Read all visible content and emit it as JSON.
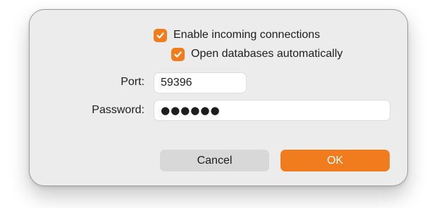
{
  "dialog": {
    "options": {
      "enable_incoming": {
        "label": "Enable incoming connections",
        "checked": true
      },
      "open_databases": {
        "label": "Open databases automatically",
        "checked": true
      }
    },
    "port": {
      "label": "Port:",
      "value": "59396"
    },
    "password": {
      "label": "Password:",
      "masked_value": "●●●●●●"
    },
    "buttons": {
      "cancel": "Cancel",
      "ok": "OK"
    }
  },
  "colors": {
    "accent": "#f07c1e",
    "dialog_background": "#ececec",
    "cancel_button": "#d8d8d8"
  },
  "icons": {
    "checkbox_mark": "checkmark-icon"
  }
}
